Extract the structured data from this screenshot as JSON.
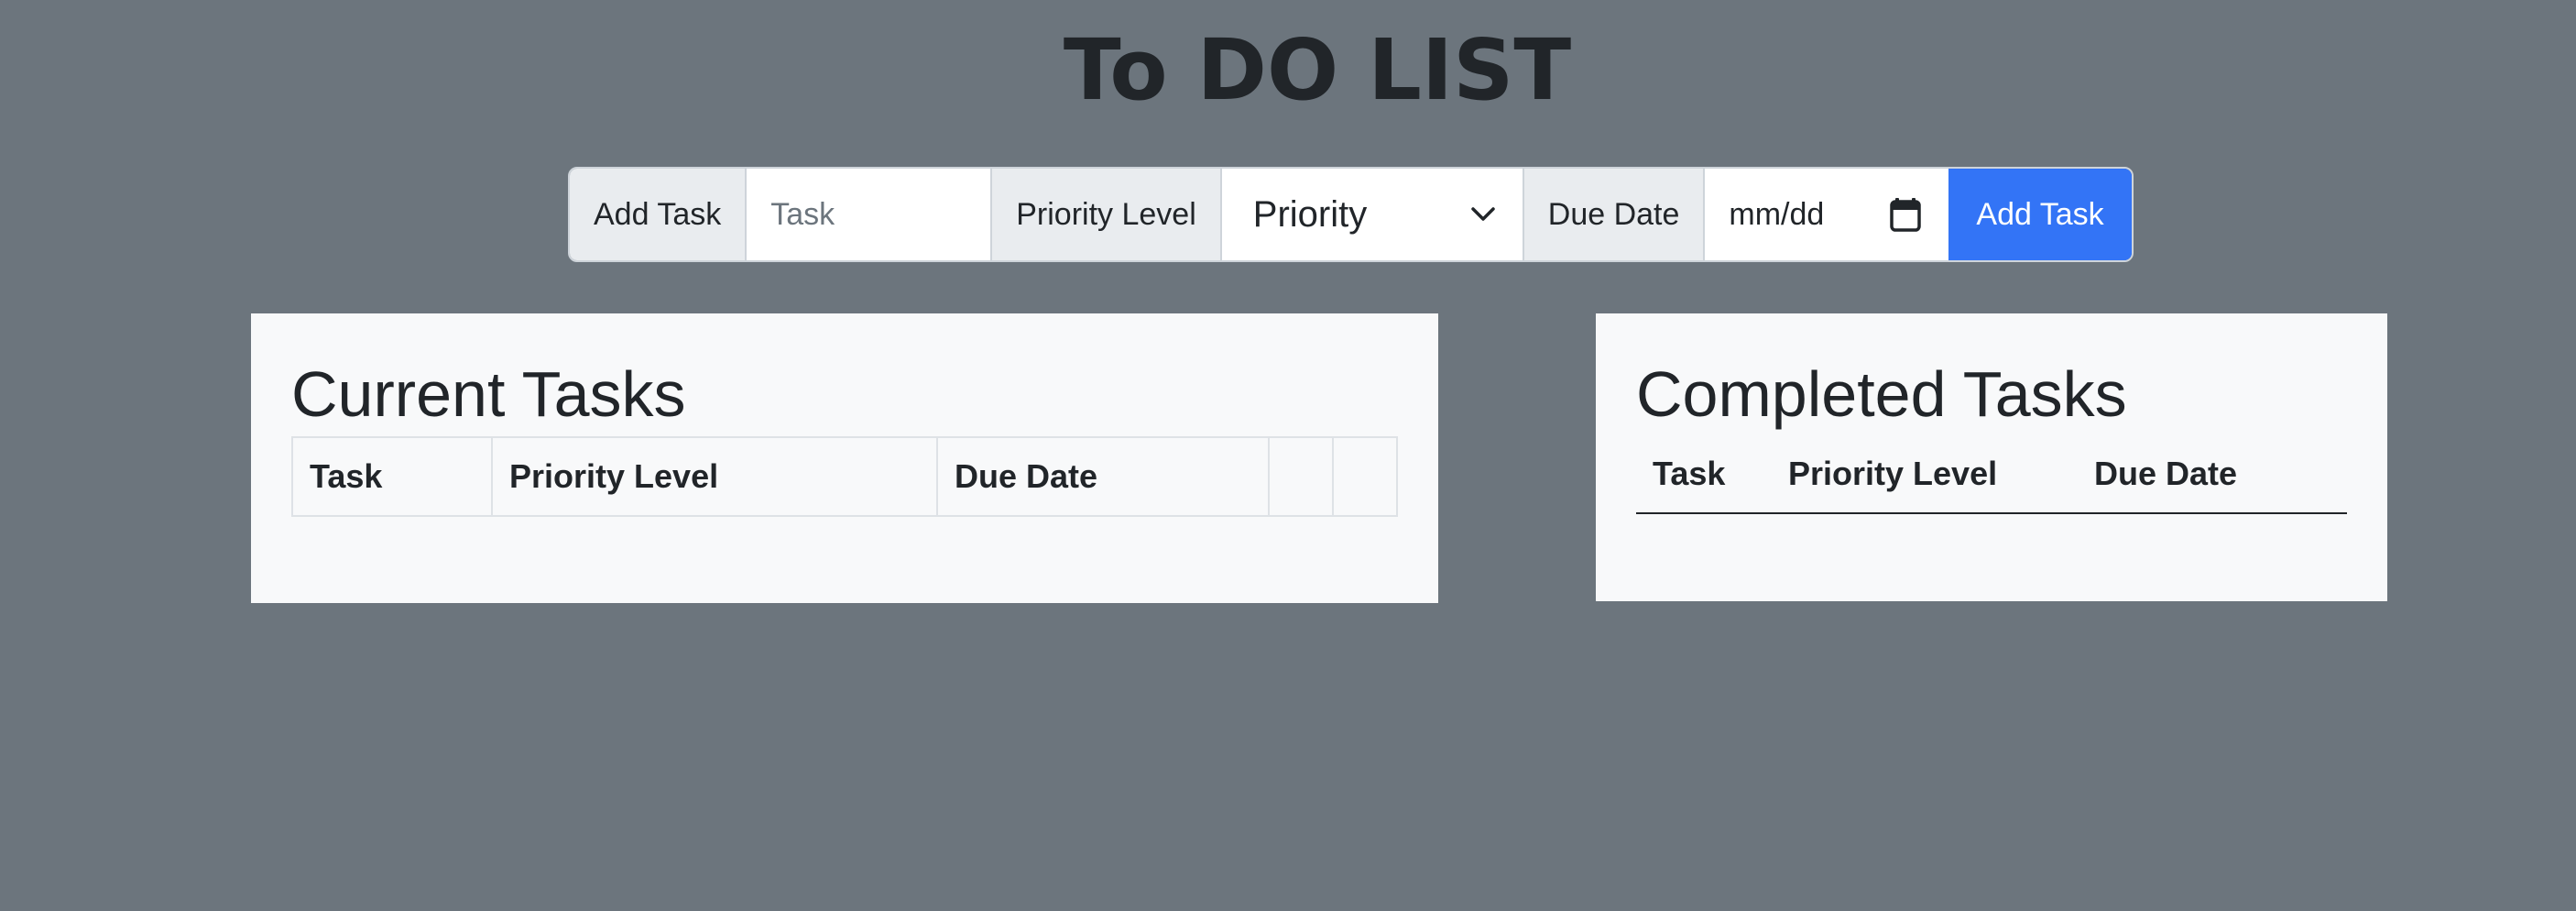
{
  "app": {
    "title": "To DO LIST"
  },
  "form": {
    "add_task_label": "Add Task",
    "task_placeholder": "Task",
    "task_value": "",
    "priority_label": "Priority Level",
    "priority_selected": "Priority",
    "due_date_label": "Due Date",
    "due_date_value": "mm/dd",
    "submit_label": "Add Task",
    "accent_color": "#3374f6"
  },
  "current": {
    "heading": "Current Tasks",
    "columns": [
      "Task",
      "Priority Level",
      "Due Date",
      "",
      ""
    ],
    "rows": []
  },
  "completed": {
    "heading": "Completed Tasks",
    "columns": [
      "Task",
      "Priority Level",
      "Due Date"
    ],
    "rows": []
  },
  "icons": {
    "priority_dropdown": "chevron-down-icon",
    "date_picker": "calendar-icon"
  }
}
